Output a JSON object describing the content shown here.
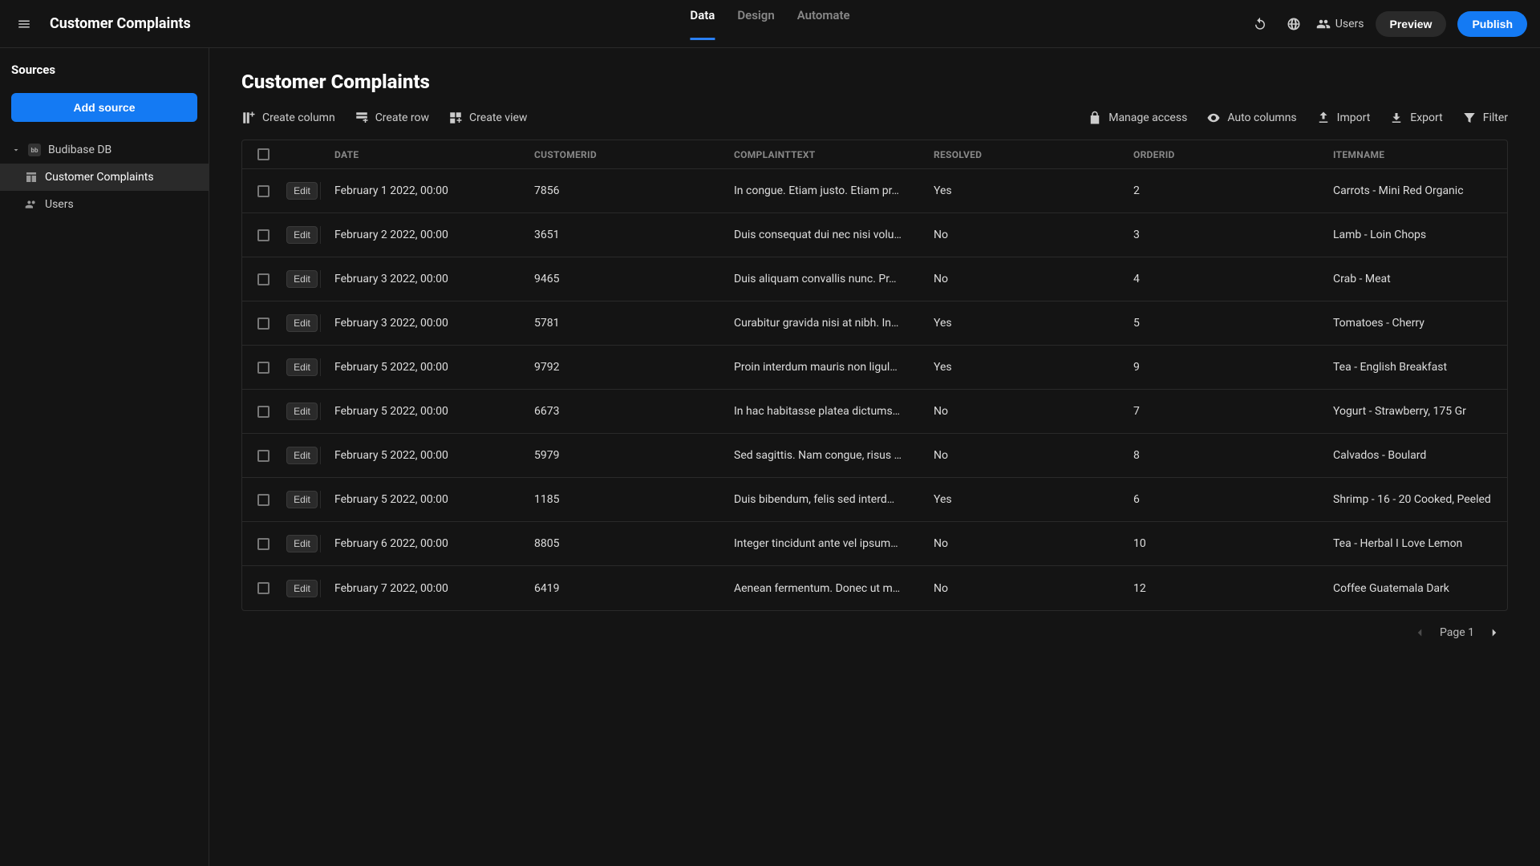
{
  "app_title": "Customer Complaints",
  "nav_tabs": {
    "data": "Data",
    "design": "Design",
    "automate": "Automate"
  },
  "topbar": {
    "users": "Users",
    "preview": "Preview",
    "publish": "Publish"
  },
  "sidebar": {
    "heading": "Sources",
    "add_source": "Add source",
    "db_name": "Budibase DB",
    "items": [
      {
        "label": "Customer Complaints"
      },
      {
        "label": "Users"
      }
    ]
  },
  "main": {
    "title": "Customer Complaints",
    "tools_left": {
      "create_column": "Create column",
      "create_row": "Create row",
      "create_view": "Create view"
    },
    "tools_right": {
      "manage_access": "Manage access",
      "auto_columns": "Auto columns",
      "import": "Import",
      "export": "Export",
      "filter": "Filter"
    },
    "edit_label": "Edit",
    "columns": {
      "date": "DATE",
      "customerid": "CUSTOMERID",
      "complainttext": "COMPLAINTTEXT",
      "resolved": "RESOLVED",
      "orderid": "ORDERID",
      "itemname": "ITEMNAME"
    },
    "rows": [
      {
        "date": "February 1 2022, 00:00",
        "customerid": "7856",
        "complainttext": "In congue. Etiam justo. Etiam pr…",
        "resolved": "Yes",
        "orderid": "2",
        "itemname": "Carrots - Mini Red Organic"
      },
      {
        "date": "February 2 2022, 00:00",
        "customerid": "3651",
        "complainttext": "Duis consequat dui nec nisi volu…",
        "resolved": "No",
        "orderid": "3",
        "itemname": "Lamb - Loin Chops"
      },
      {
        "date": "February 3 2022, 00:00",
        "customerid": "9465",
        "complainttext": "Duis aliquam convallis nunc. Pr…",
        "resolved": "No",
        "orderid": "4",
        "itemname": "Crab - Meat"
      },
      {
        "date": "February 3 2022, 00:00",
        "customerid": "5781",
        "complainttext": "Curabitur gravida nisi at nibh. In…",
        "resolved": "Yes",
        "orderid": "5",
        "itemname": "Tomatoes - Cherry"
      },
      {
        "date": "February 5 2022, 00:00",
        "customerid": "9792",
        "complainttext": "Proin interdum mauris non ligul…",
        "resolved": "Yes",
        "orderid": "9",
        "itemname": "Tea - English Breakfast"
      },
      {
        "date": "February 5 2022, 00:00",
        "customerid": "6673",
        "complainttext": "In hac habitasse platea dictums…",
        "resolved": "No",
        "orderid": "7",
        "itemname": "Yogurt - Strawberry, 175 Gr"
      },
      {
        "date": "February 5 2022, 00:00",
        "customerid": "5979",
        "complainttext": "Sed sagittis. Nam congue, risus …",
        "resolved": "No",
        "orderid": "8",
        "itemname": "Calvados - Boulard"
      },
      {
        "date": "February 5 2022, 00:00",
        "customerid": "1185",
        "complainttext": "Duis bibendum, felis sed interd…",
        "resolved": "Yes",
        "orderid": "6",
        "itemname": "Shrimp - 16 - 20 Cooked, Peeled"
      },
      {
        "date": "February 6 2022, 00:00",
        "customerid": "8805",
        "complainttext": "Integer tincidunt ante vel ipsum…",
        "resolved": "No",
        "orderid": "10",
        "itemname": "Tea - Herbal I Love Lemon"
      },
      {
        "date": "February 7 2022, 00:00",
        "customerid": "6419",
        "complainttext": "Aenean fermentum. Donec ut m…",
        "resolved": "No",
        "orderid": "12",
        "itemname": "Coffee Guatemala Dark"
      }
    ],
    "pager": {
      "page_label": "Page 1"
    }
  }
}
